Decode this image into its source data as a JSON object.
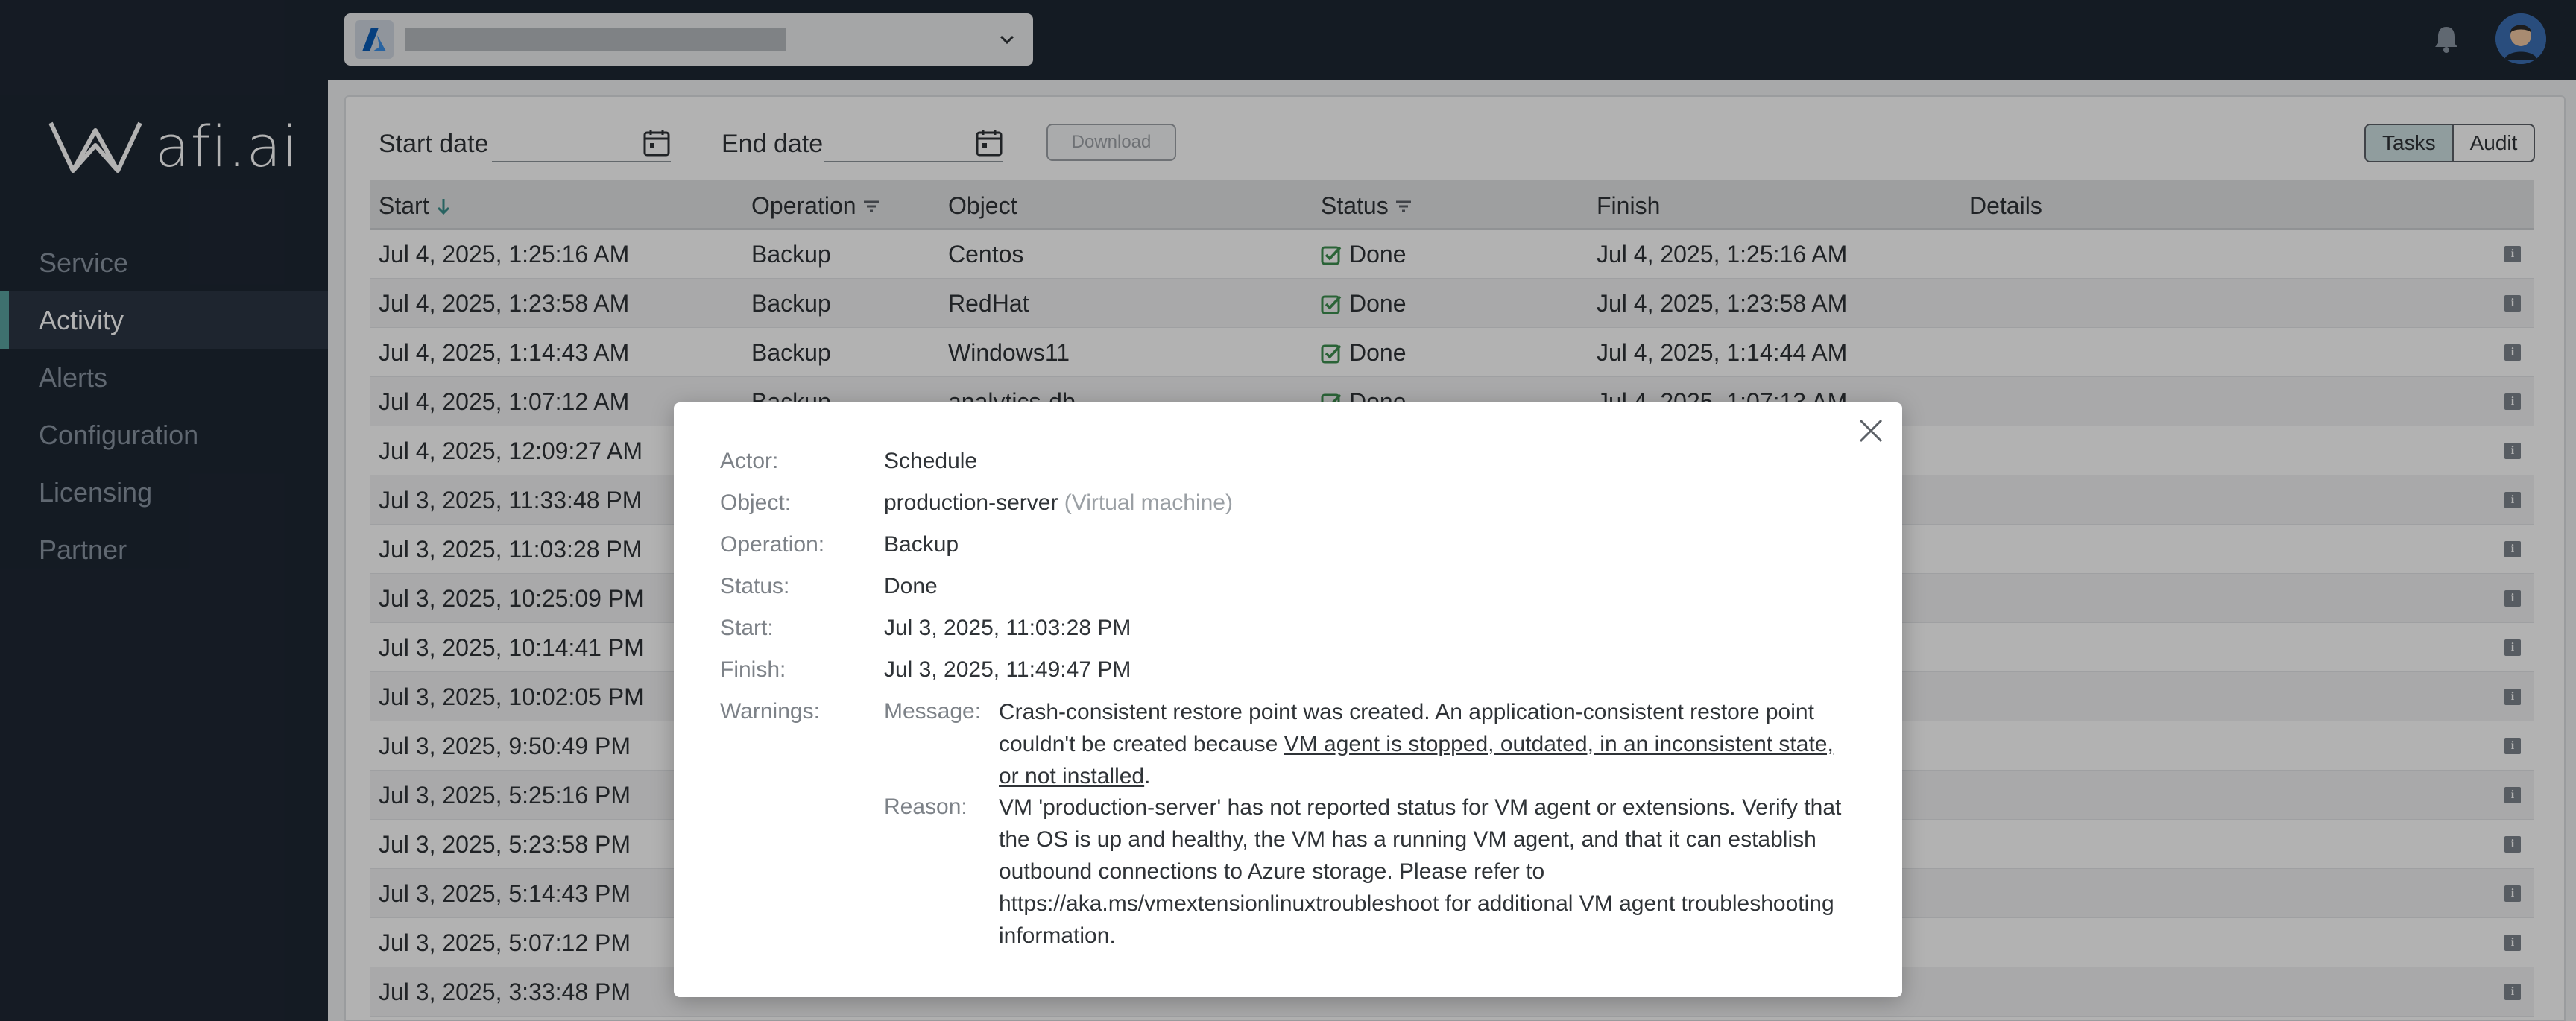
{
  "brand": {
    "name": "afi.ai",
    "accent": "#5aa3a0"
  },
  "sidebar": {
    "items": [
      {
        "label": "Service",
        "active": false
      },
      {
        "label": "Activity",
        "active": true
      },
      {
        "label": "Alerts",
        "active": false
      },
      {
        "label": "Configuration",
        "active": false
      },
      {
        "label": "Licensing",
        "active": false
      },
      {
        "label": "Partner",
        "active": false
      }
    ]
  },
  "topbar": {
    "tenant_icon": "azure-icon",
    "tenant_value": "",
    "notifications_icon": "bell-icon",
    "avatar_icon": "user-avatar"
  },
  "filters": {
    "start_label": "Start date",
    "end_label": "End date",
    "start_value": "",
    "end_value": "",
    "download_label": "Download",
    "view_tabs": [
      {
        "label": "Tasks",
        "selected": true
      },
      {
        "label": "Audit",
        "selected": false
      }
    ]
  },
  "table": {
    "columns": [
      "Start",
      "Operation",
      "Object",
      "Status",
      "Finish",
      "Details"
    ],
    "rows": [
      {
        "start": "Jul 4, 2025, 1:25:16 AM",
        "operation": "Backup",
        "object": "Centos",
        "status": "Done",
        "finish": "Jul 4, 2025, 1:25:16 AM"
      },
      {
        "start": "Jul 4, 2025, 1:23:58 AM",
        "operation": "Backup",
        "object": "RedHat",
        "status": "Done",
        "finish": "Jul 4, 2025, 1:23:58 AM"
      },
      {
        "start": "Jul 4, 2025, 1:14:43 AM",
        "operation": "Backup",
        "object": "Windows11",
        "status": "Done",
        "finish": "Jul 4, 2025, 1:14:44 AM"
      },
      {
        "start": "Jul 4, 2025, 1:07:12 AM",
        "operation": "Backup",
        "object": "analytics-db",
        "status": "Done",
        "finish": "Jul 4, 2025, 1:07:13 AM"
      },
      {
        "start": "Jul 4, 2025, 12:09:27 AM",
        "operation": "",
        "object": "",
        "status": "",
        "finish": ""
      },
      {
        "start": "Jul 3, 2025, 11:33:48 PM",
        "operation": "",
        "object": "",
        "status": "",
        "finish": ""
      },
      {
        "start": "Jul 3, 2025, 11:03:28 PM",
        "operation": "",
        "object": "",
        "status": "",
        "finish": ""
      },
      {
        "start": "Jul 3, 2025, 10:25:09 PM",
        "operation": "",
        "object": "",
        "status": "",
        "finish": ""
      },
      {
        "start": "Jul 3, 2025, 10:14:41 PM",
        "operation": "",
        "object": "",
        "status": "",
        "finish": ""
      },
      {
        "start": "Jul 3, 2025, 10:02:05 PM",
        "operation": "",
        "object": "",
        "status": "",
        "finish": ""
      },
      {
        "start": "Jul 3, 2025, 9:50:49 PM",
        "operation": "",
        "object": "",
        "status": "",
        "finish": ""
      },
      {
        "start": "Jul 3, 2025, 5:25:16 PM",
        "operation": "",
        "object": "",
        "status": "",
        "finish": ""
      },
      {
        "start": "Jul 3, 2025, 5:23:58 PM",
        "operation": "",
        "object": "",
        "status": "",
        "finish": ""
      },
      {
        "start": "Jul 3, 2025, 5:14:43 PM",
        "operation": "",
        "object": "",
        "status": "",
        "finish": ""
      },
      {
        "start": "Jul 3, 2025, 5:07:12 PM",
        "operation": "",
        "object": "",
        "status": "",
        "finish": ""
      },
      {
        "start": "Jul 3, 2025, 3:33:48 PM",
        "operation": "",
        "object": "",
        "status": "",
        "finish": ""
      }
    ]
  },
  "modal": {
    "actor_label": "Actor:",
    "actor": "Schedule",
    "object_label": "Object:",
    "object": "production-server",
    "object_type": "(Virtual machine)",
    "operation_label": "Operation:",
    "operation": "Backup",
    "status_label": "Status:",
    "status": "Done",
    "start_label": "Start:",
    "start": "Jul 3, 2025, 11:03:28 PM",
    "finish_label": "Finish:",
    "finish": "Jul 3, 2025, 11:49:47 PM",
    "warnings_label": "Warnings:",
    "message_label": "Message:",
    "message_text": "Crash-consistent restore point was created. An application-consistent restore point couldn't be created because ",
    "message_link": "VM agent is stopped, outdated, in an inconsistent state, or not installed",
    "message_end": ".",
    "reason_label": "Reason:",
    "reason_text": "VM 'production-server' has not reported status for VM agent or extensions. Verify that the OS is up and healthy, the VM has a running VM agent, and that it can establish outbound connections to Azure storage. Please refer to https://aka.ms/vmextensionlinuxtroubleshoot for additional VM agent troubleshooting information."
  }
}
